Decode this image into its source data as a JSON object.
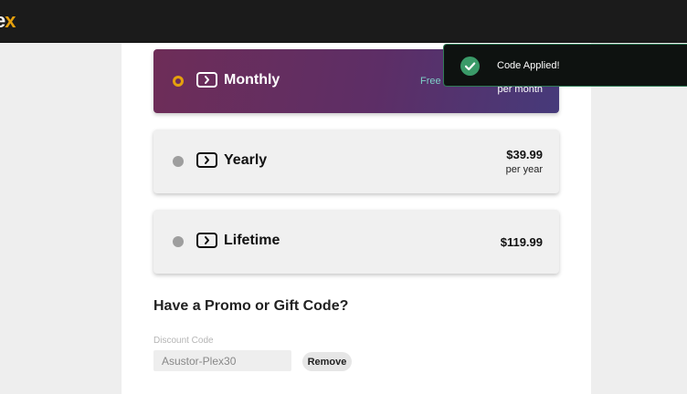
{
  "header": {
    "logo_left": "e",
    "logo_right": "x"
  },
  "plans": [
    {
      "name": "Monthly",
      "price": "",
      "period": "per month",
      "free_text": "Free",
      "selected": true
    },
    {
      "name": "Yearly",
      "price": "$39.99",
      "period": "per year",
      "selected": false
    },
    {
      "name": "Lifetime",
      "price": "$119.99",
      "period": "",
      "selected": false
    }
  ],
  "promo": {
    "title": "Have a Promo or Gift Code?",
    "discount_label": "Discount Code",
    "discount_value": "Asustor-Plex30",
    "remove_label": "Remove"
  },
  "toast": {
    "message": "Code Applied!",
    "icon": "check-circle-icon"
  },
  "colors": {
    "brand": "#e5a00d",
    "topbar": "#1b1b1b",
    "success": "#3a9a68",
    "selected_gradient_start": "#6e2d58",
    "selected_gradient_end": "#463a7a"
  }
}
